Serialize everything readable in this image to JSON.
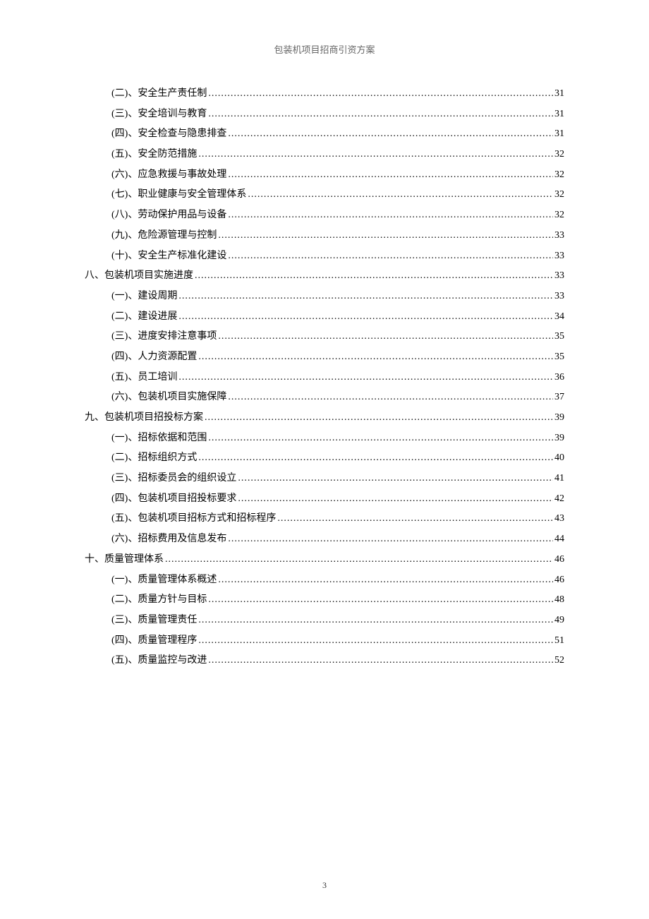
{
  "header": {
    "title": "包装机项目招商引资方案"
  },
  "toc": {
    "entries": [
      {
        "level": 2,
        "label": "(二)、安全生产责任制",
        "page": "31"
      },
      {
        "level": 2,
        "label": "(三)、安全培训与教育",
        "page": "31"
      },
      {
        "level": 2,
        "label": "(四)、安全检查与隐患排查",
        "page": "31"
      },
      {
        "level": 2,
        "label": "(五)、安全防范措施",
        "page": "32"
      },
      {
        "level": 2,
        "label": "(六)、应急救援与事故处理",
        "page": "32"
      },
      {
        "level": 2,
        "label": "(七)、职业健康与安全管理体系",
        "page": "32"
      },
      {
        "level": 2,
        "label": "(八)、劳动保护用品与设备",
        "page": "32"
      },
      {
        "level": 2,
        "label": "(九)、危险源管理与控制",
        "page": "33"
      },
      {
        "level": 2,
        "label": "(十)、安全生产标准化建设",
        "page": "33"
      },
      {
        "level": 1,
        "label": "八、包装机项目实施进度",
        "page": "33"
      },
      {
        "level": 2,
        "label": "(一)、建设周期",
        "page": "33"
      },
      {
        "level": 2,
        "label": "(二)、建设进展",
        "page": "34"
      },
      {
        "level": 2,
        "label": "(三)、进度安排注意事项",
        "page": "35"
      },
      {
        "level": 2,
        "label": "(四)、人力资源配置",
        "page": "35"
      },
      {
        "level": 2,
        "label": "(五)、员工培训",
        "page": "36"
      },
      {
        "level": 2,
        "label": "(六)、包装机项目实施保障",
        "page": "37"
      },
      {
        "level": 1,
        "label": "九、包装机项目招投标方案",
        "page": "39"
      },
      {
        "level": 2,
        "label": "(一)、招标依据和范围",
        "page": "39"
      },
      {
        "level": 2,
        "label": "(二)、招标组织方式",
        "page": "40"
      },
      {
        "level": 2,
        "label": "(三)、招标委员会的组织设立",
        "page": "41"
      },
      {
        "level": 2,
        "label": "(四)、包装机项目招投标要求",
        "page": "42"
      },
      {
        "level": 2,
        "label": "(五)、包装机项目招标方式和招标程序",
        "page": "43"
      },
      {
        "level": 2,
        "label": "(六)、招标费用及信息发布",
        "page": "44"
      },
      {
        "level": 1,
        "label": "十、质量管理体系",
        "page": "46"
      },
      {
        "level": 2,
        "label": "(一)、质量管理体系概述",
        "page": "46"
      },
      {
        "level": 2,
        "label": "(二)、质量方针与目标",
        "page": "48"
      },
      {
        "level": 2,
        "label": "(三)、质量管理责任",
        "page": "49"
      },
      {
        "level": 2,
        "label": "(四)、质量管理程序",
        "page": "51"
      },
      {
        "level": 2,
        "label": "(五)、质量监控与改进",
        "page": "52"
      }
    ]
  },
  "pageNumber": "3"
}
